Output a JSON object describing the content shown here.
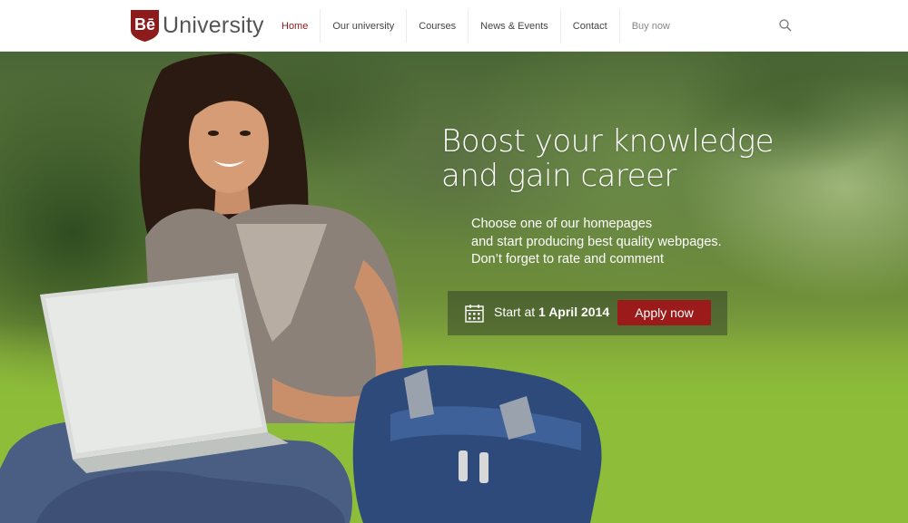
{
  "header": {
    "logo_mark": "Bē",
    "logo_text": "University",
    "nav": [
      {
        "label": "Home",
        "active": true
      },
      {
        "label": "Our university",
        "active": false
      },
      {
        "label": "Courses",
        "active": false
      },
      {
        "label": "News & Events",
        "active": false
      },
      {
        "label": "Contact",
        "active": false
      },
      {
        "label": "Buy now",
        "active": false
      }
    ],
    "search_icon": "search-icon"
  },
  "hero": {
    "headline_line1": "Boost your knowledge",
    "headline_line2": "and gain career",
    "sub_line1": "Choose one of our homepages",
    "sub_line2": "and start producing best quality webpages.",
    "sub_line3": "Don’t forget to rate and comment",
    "cta_prefix": "Start at",
    "cta_date": "1 April 2014",
    "apply_label": "Apply now",
    "calendar_icon": "calendar-icon"
  },
  "colors": {
    "accent": "#9b1b1b",
    "active_nav": "#8e1b1b"
  }
}
